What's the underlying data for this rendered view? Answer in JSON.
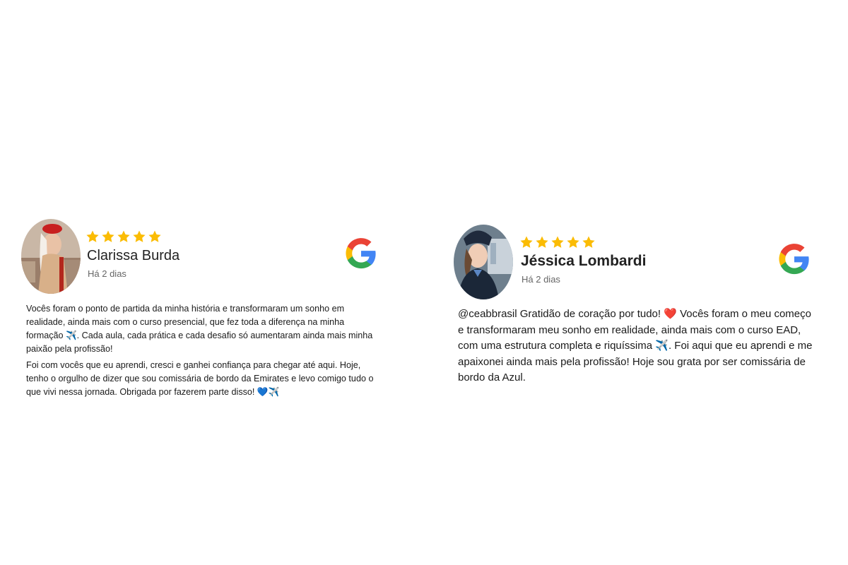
{
  "reviews": [
    {
      "name": "Clarissa Burda",
      "date": "Há 2 dias",
      "rating": 5,
      "avatar_icon": "avatar-photo",
      "source_icon": "google-icon",
      "paragraphs": [
        "Vocês foram o ponto de partida da minha história e transformaram um sonho em realidade, ainda mais com o curso presencial, que fez toda a diferença na minha formação ✈️. Cada aula, cada prática e cada desafio só aumentaram ainda mais minha paixão pela profissão!",
        "Foi com vocês que eu aprendi, cresci e ganhei confiança para chegar até aqui. Hoje, tenho o orgulho de dizer que sou comissária de bordo da Emirates e levo comigo tudo o que vivi nessa jornada. Obrigada por fazerem parte disso! 💙✈️"
      ]
    },
    {
      "name": "Jéssica Lombardi",
      "date": "Há 2 dias",
      "rating": 5,
      "avatar_icon": "avatar-photo",
      "source_icon": "google-icon",
      "paragraphs": [
        "@ceabbrasil Gratidão de coração por tudo! ❤️ Vocês foram o meu começo e transformaram meu sonho em realidade, ainda mais com o curso EAD, com uma estrutura completa e riquíssima ✈️. Foi aqui que eu aprendi e me apaixonei ainda mais pela profissão! Hoje sou grata por ser comissária de bordo da Azul."
      ]
    }
  ],
  "colors": {
    "star": "#FBBC04",
    "google_blue": "#4285F4",
    "google_red": "#EA4335",
    "google_yellow": "#FBBC05",
    "google_green": "#34A853"
  }
}
